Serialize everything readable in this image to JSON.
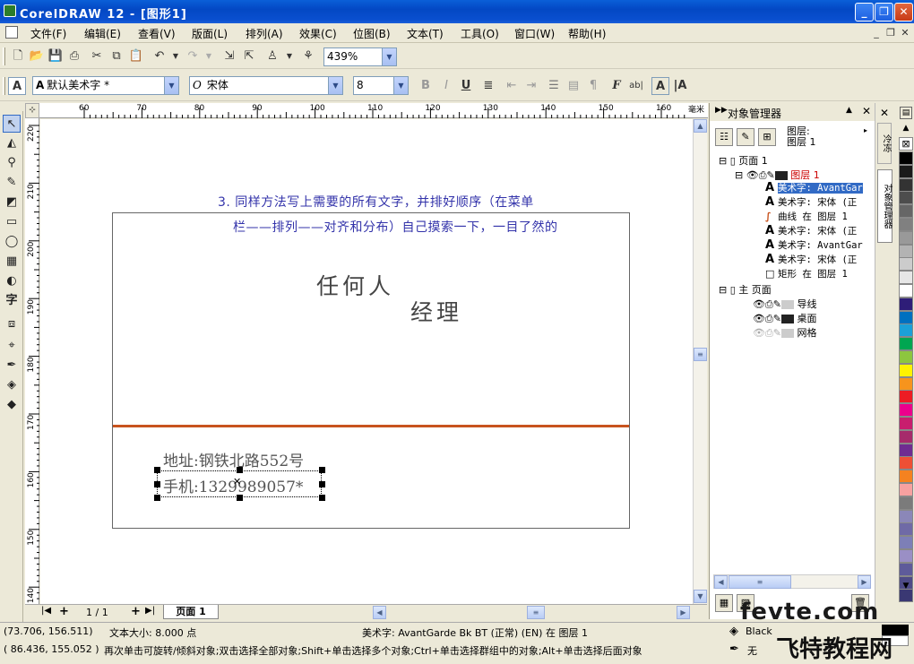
{
  "window": {
    "title": "CorelDRAW 12 - [图形1]"
  },
  "menu": [
    "文件(F)",
    "编辑(E)",
    "查看(V)",
    "版面(L)",
    "排列(A)",
    "效果(C)",
    "位图(B)",
    "文本(T)",
    "工具(O)",
    "窗口(W)",
    "帮助(H)"
  ],
  "toolbar": {
    "zoom": "439%"
  },
  "textbar": {
    "style": "默认美术字 *",
    "font": "宋体",
    "size": "8"
  },
  "ruler": {
    "unit": "毫米",
    "h_ticks": [
      "60",
      "70",
      "80",
      "90",
      "100",
      "110",
      "120",
      "130",
      "140",
      "150",
      "160"
    ],
    "v_ticks": [
      "220",
      "210",
      "200",
      "190",
      "180",
      "170",
      "160",
      "150",
      "140"
    ]
  },
  "document": {
    "instruction_line1": "3. 同样方法写上需要的所有文字，并排好顺序（在菜单",
    "instruction_line2": "栏——排列——对齐和分布）自己摸索一下，一目了然的",
    "name": "任何人",
    "position": "经理",
    "address": "地址:钢铁北路552号",
    "phone": "手机:1329989057*"
  },
  "pagebar": {
    "page_count": "1 / 1",
    "page_tab": "页面 1"
  },
  "object_manager": {
    "title": "对象管理器",
    "layer_label": "图层:",
    "layer_value": "图层 1",
    "page1": "页面 1",
    "layer1": "图层 1",
    "items": [
      {
        "label": "美术字: AvantGar",
        "icon": "A",
        "selected": true
      },
      {
        "label": "美术字: 宋体 (正",
        "icon": "A",
        "selected": false
      },
      {
        "label": "曲线 在 图层 1",
        "icon": "curve",
        "selected": false
      },
      {
        "label": "美术字: 宋体 (正",
        "icon": "A",
        "selected": false
      },
      {
        "label": "美术字: AvantGar",
        "icon": "A",
        "selected": false
      },
      {
        "label": "美术字: 宋体 (正",
        "icon": "A",
        "selected": false
      },
      {
        "label": "矩形 在 图层 1",
        "icon": "rect",
        "selected": false
      }
    ],
    "master": "主 页面",
    "master_items": [
      "导线",
      "桌面",
      "网格"
    ]
  },
  "docker_tabs": [
    "冷冻",
    "对象管理器"
  ],
  "status": {
    "coords1": "(73.706, 156.511)",
    "text_size": "文本大小: 8.000 点",
    "object_info": "美术字: AvantGarde Bk BT (正常) (EN) 在 图层 1",
    "coords2": "( 86.436, 155.052 )",
    "hint": "再次单击可旋转/倾斜对象;双击选择全部对象;Shift+单击选择多个对象;Ctrl+单击选择群组中的对象;Alt+单击选择后面对象",
    "fill": "Black",
    "outline": "无"
  },
  "watermark": {
    "site": "fevte.com",
    "name": "飞特教程网"
  },
  "colors": {
    "accent_line": "#c8531e",
    "instruction_text": "#3333aa",
    "selection": "#316ac5"
  }
}
